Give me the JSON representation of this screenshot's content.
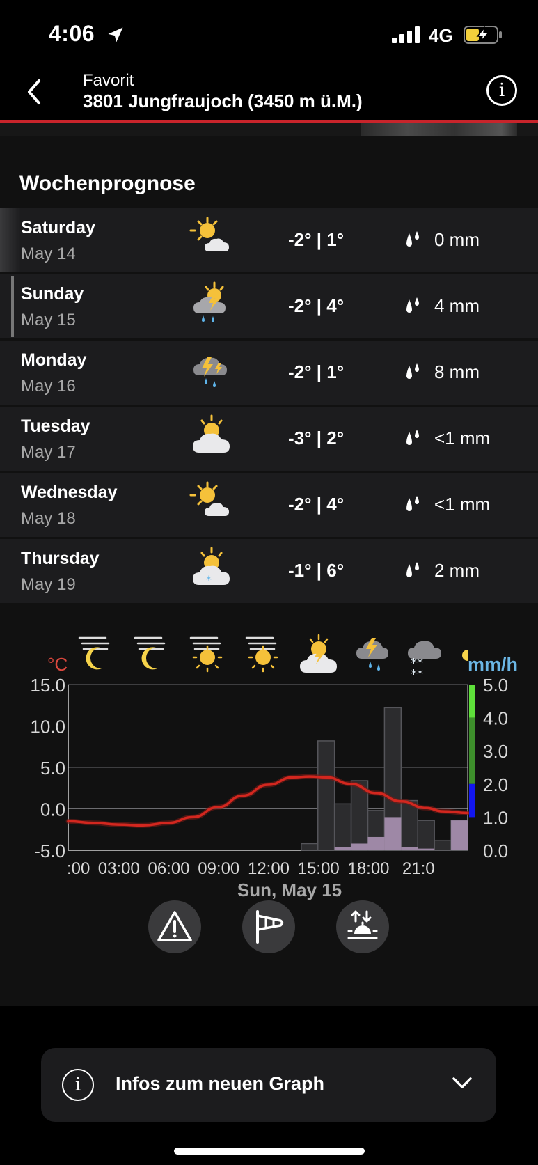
{
  "status_bar": {
    "time": "4:06",
    "network": "4G",
    "battery_icon": "battery-charging-icon"
  },
  "nav": {
    "subtitle": "Favorit",
    "title": "3801 Jungfraujoch (3450 m ü.M.)",
    "info_label": "i"
  },
  "section": {
    "title": "Wochenprognose"
  },
  "forecast": [
    {
      "day": "Saturday",
      "date": "May 14",
      "icon": "sun-cloud-icon",
      "temps": "-2° | 1°",
      "precip": "0 mm"
    },
    {
      "day": "Sunday",
      "date": "May 15",
      "icon": "thunderstorm-rain-sun-icon",
      "temps": "-2° | 4°",
      "precip": "4 mm"
    },
    {
      "day": "Monday",
      "date": "May 16",
      "icon": "thunderstorm-rain-icon",
      "temps": "-2° | 1°",
      "precip": "8 mm"
    },
    {
      "day": "Tuesday",
      "date": "May 17",
      "icon": "cloud-sun-icon",
      "temps": "-3° | 2°",
      "precip": "<1 mm"
    },
    {
      "day": "Wednesday",
      "date": "May 18",
      "icon": "sun-cloud-icon",
      "temps": "-2° | 4°",
      "precip": "<1 mm"
    },
    {
      "day": "Thursday",
      "date": "May 19",
      "icon": "snow-sun-cloud-icon",
      "temps": "-1° | 6°",
      "precip": "2 mm"
    }
  ],
  "chart_data": {
    "type": "line",
    "title": "",
    "xlabel": "Sun, May 15",
    "ylabel_left": "°C",
    "ylabel_right": "mm/h",
    "x_ticks": [
      ":00",
      "03:00",
      "06:00",
      "09:00",
      "12:00",
      "15:00",
      "18:00",
      "21:0"
    ],
    "y_ticks_left": [
      "15.0",
      "10.0",
      "5.0",
      "0.0",
      "-5.0"
    ],
    "y_ticks_right": [
      "5.0",
      "4.0",
      "3.0",
      "2.0",
      "1.0",
      "0.0"
    ],
    "ylim_left": [
      -5,
      15
    ],
    "ylim_right": [
      0,
      5
    ],
    "xlim": [
      0,
      24
    ],
    "temperature": {
      "name": "Temperature",
      "x": [
        0,
        1.5,
        3,
        4.5,
        6,
        7.5,
        9,
        10.5,
        12,
        13.5,
        14.5,
        15.5,
        17,
        18.5,
        20,
        21.5,
        22.5,
        24
      ],
      "y": [
        -1.5,
        -1.7,
        -1.9,
        -2.0,
        -1.7,
        -1.0,
        0.2,
        1.6,
        2.9,
        3.8,
        3.9,
        3.8,
        3.0,
        1.9,
        0.9,
        0.1,
        -0.3,
        -0.5
      ]
    },
    "precip_upper": {
      "x": [
        14,
        15,
        16,
        17,
        18,
        19,
        20,
        21,
        22,
        23
      ],
      "values": [
        0.2,
        3.3,
        1.4,
        2.1,
        1.2,
        4.3,
        1.5,
        0.9,
        0.3,
        0.9
      ]
    },
    "precip_probable": {
      "x": [
        14,
        15,
        16,
        17,
        18,
        19,
        20,
        21,
        22,
        23
      ],
      "values": [
        0,
        0,
        0.1,
        0.2,
        0.4,
        1.0,
        0.1,
        0.05,
        0,
        0.9
      ]
    },
    "scale_bar": [
      {
        "from": 4,
        "to": 5,
        "color": "#5ee03a"
      },
      {
        "from": 2,
        "to": 4,
        "color": "#3d8f2b"
      },
      {
        "from": 1,
        "to": 2,
        "color": "#1216ee"
      }
    ],
    "hourly_icons": [
      "wind-moon-icon",
      "wind-moon-icon",
      "wind-sun-icon",
      "wind-sun-icon",
      "sun-thunder-cloud-icon",
      "thunderstorm-rain-icon",
      "snow-cloud-icon"
    ],
    "colors": {
      "temperature": "#d3271f",
      "precip_upper": "#3a3a3c",
      "precip_probable": "#9e88a6",
      "left_axis": "#d9473d",
      "right_axis": "#6bb6e4"
    }
  },
  "actions": [
    "warning-triangle-icon",
    "windsock-icon",
    "sunrise-sunset-icon"
  ],
  "info_bar": {
    "label": "Infos zum neuen Graph",
    "icon": "info-circle-icon",
    "chevron": "chevron-down-icon"
  }
}
